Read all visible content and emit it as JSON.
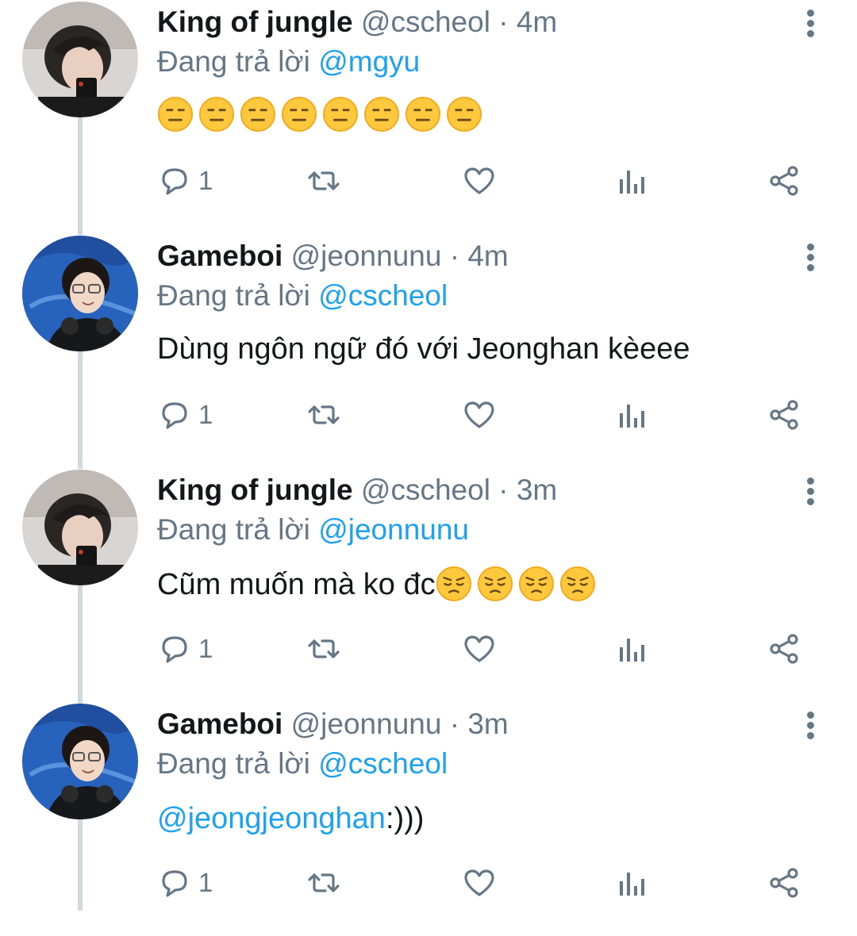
{
  "thread": {
    "reply_prefix": "Đang trả lời",
    "tweets": [
      {
        "name": "King of jungle",
        "handle": "@cscheol",
        "separator": "·",
        "time": "4m",
        "reply_to": "@mgyu",
        "text": "",
        "emoji": [
          "expressionless-face",
          "expressionless-face",
          "expressionless-face",
          "expressionless-face",
          "expressionless-face",
          "expressionless-face",
          "expressionless-face",
          "expressionless-face"
        ],
        "reply_count": "1",
        "avatar": "dark-haired-person-avatar"
      },
      {
        "name": "Gameboi",
        "handle": "@jeonnunu",
        "separator": "·",
        "time": "4m",
        "reply_to": "@cscheol",
        "text": "Dùng ngôn ngữ đó với Jeonghan kèeee",
        "emoji": [],
        "reply_count": "1",
        "avatar": "person-with-glasses-avatar"
      },
      {
        "name": "King of jungle",
        "handle": "@cscheol",
        "separator": "·",
        "time": "3m",
        "reply_to": "@jeonnunu",
        "text": "Cũm muốn mà ko đc",
        "emoji": [
          "pensive-face",
          "pensive-face",
          "pensive-face",
          "pensive-face"
        ],
        "reply_count": "1",
        "avatar": "dark-haired-person-avatar"
      },
      {
        "name": "Gameboi",
        "handle": "@jeonnunu",
        "separator": "·",
        "time": "3m",
        "reply_to": "@cscheol",
        "text_mention": "@jeongjeonghan",
        "text": ":)))",
        "emoji": [],
        "reply_count": "1",
        "avatar": "person-with-glasses-avatar"
      }
    ]
  },
  "colors": {
    "name": "#14171a",
    "secondary": "#657786",
    "mention": "#1da1f2",
    "thread_line": "#cfd9de",
    "icon": "#657786"
  },
  "icons": {
    "reply": "reply-icon",
    "retweet": "retweet-icon",
    "like": "heart-icon",
    "analytics": "analytics-icon",
    "share": "share-icon",
    "more": "more-vertical-icon"
  }
}
